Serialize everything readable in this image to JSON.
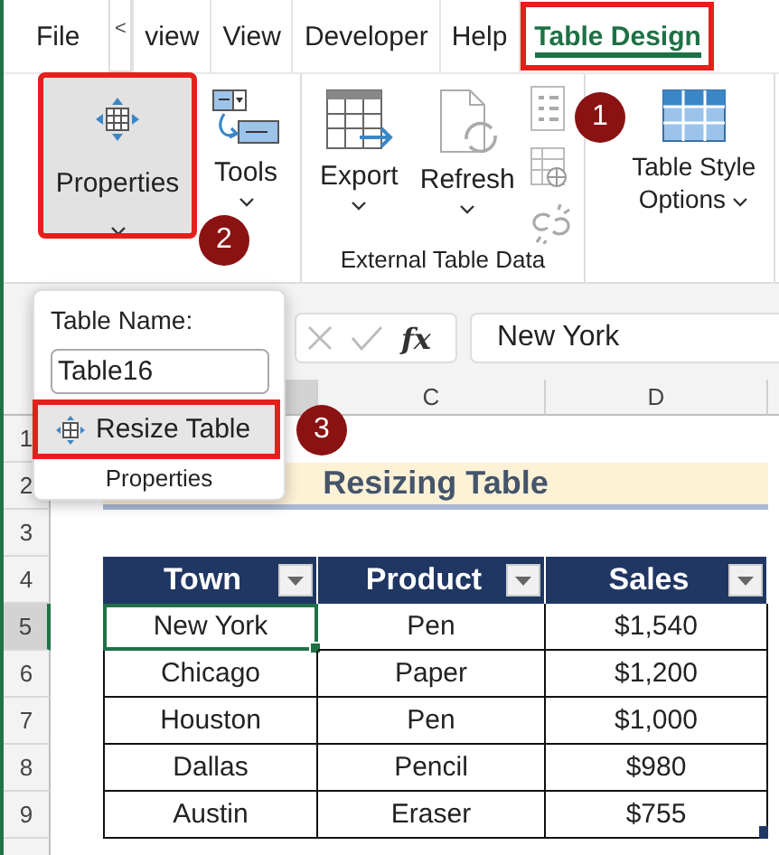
{
  "tabs": [
    {
      "kind": "tab",
      "label": "File",
      "selected": false,
      "highlighted": false
    },
    {
      "kind": "scroll",
      "label": "<"
    },
    {
      "kind": "tab",
      "label": "view",
      "selected": false,
      "highlighted": false
    },
    {
      "kind": "tab",
      "label": "View",
      "selected": false,
      "highlighted": false
    },
    {
      "kind": "tab",
      "label": "Developer",
      "selected": false,
      "highlighted": false
    },
    {
      "kind": "tab",
      "label": "Help",
      "selected": false,
      "highlighted": false
    },
    {
      "kind": "tab",
      "label": "Table Design",
      "selected": true,
      "highlighted": true
    }
  ],
  "ribbon": {
    "groups": [
      {
        "buttons": [
          {
            "kind": "properties",
            "label": "Properties",
            "pressed": true,
            "highlighted": true
          },
          {
            "kind": "tools",
            "label": "Tools",
            "pressed": false,
            "highlighted": false
          }
        ]
      },
      {
        "label": "External Table Data",
        "buttons": [
          {
            "kind": "export",
            "label": "Export",
            "pressed": false,
            "highlighted": false
          },
          {
            "kind": "refresh",
            "label": "Refresh",
            "pressed": false,
            "highlighted": false
          },
          {
            "kind": "small",
            "pressed": false,
            "highlighted": false
          }
        ]
      },
      {
        "buttons": [
          {
            "kind": "style",
            "label": "Table Style Options",
            "pressed": false,
            "highlighted": false
          }
        ]
      }
    ]
  },
  "formula_bar": {
    "function_label": "fx",
    "value": "New York"
  },
  "column_headers": [
    {
      "selected": true
    },
    {
      "label": "C",
      "selected": false
    },
    {
      "label": "D",
      "selected": false
    }
  ],
  "row_headers": [
    {
      "label": "1",
      "selected": false
    },
    {
      "label": "2",
      "selected": false
    },
    {
      "label": "3",
      "selected": false
    },
    {
      "label": "4",
      "selected": false
    },
    {
      "label": "5",
      "selected": true
    },
    {
      "label": "6",
      "selected": false
    },
    {
      "label": "7",
      "selected": false
    },
    {
      "label": "8",
      "selected": false
    },
    {
      "label": "9",
      "selected": false
    }
  ],
  "sheet_title": "Resizing Table",
  "table": {
    "columns": [
      "Town",
      "Product",
      "Sales"
    ],
    "rows": [
      {
        "cells": [
          "New York",
          "Pen",
          "$1,540"
        ],
        "selected": true
      },
      {
        "cells": [
          "Chicago",
          "Paper",
          "$1,200"
        ],
        "selected": false
      },
      {
        "cells": [
          "Houston",
          "Pen",
          "$1,000"
        ],
        "selected": false
      },
      {
        "cells": [
          "Dallas",
          "Pencil",
          "$980"
        ],
        "selected": false
      },
      {
        "cells": [
          "Austin",
          "Eraser",
          "$755"
        ],
        "selected": false
      }
    ]
  },
  "popup": {
    "name_label": "Table Name:",
    "name_value": "Table16",
    "action": {
      "label": "Resize Table",
      "highlighted": true
    },
    "group_label": "Properties"
  },
  "badges": [
    {
      "text": "1"
    },
    {
      "text": "2"
    },
    {
      "text": "3"
    }
  ]
}
